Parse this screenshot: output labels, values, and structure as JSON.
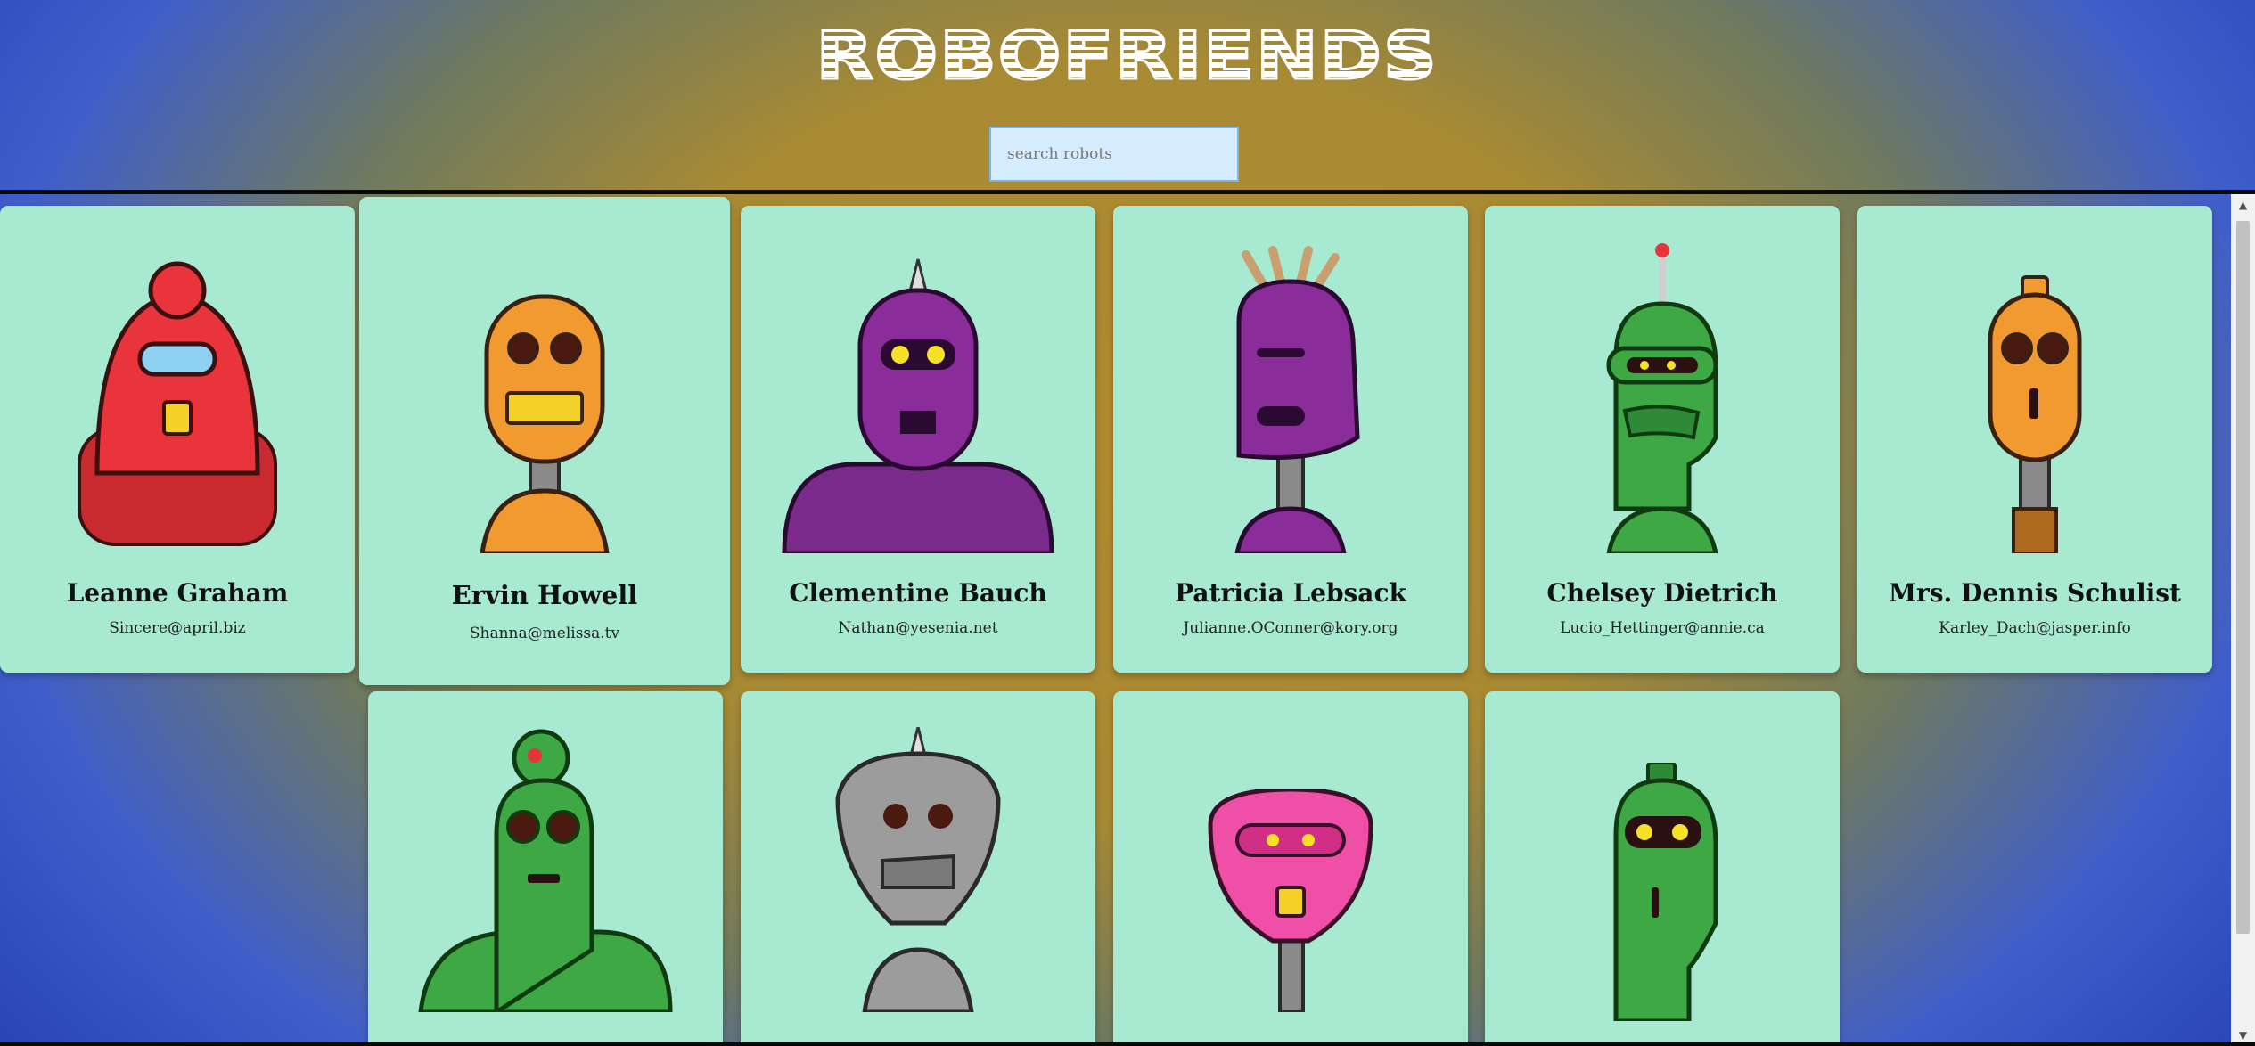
{
  "app": {
    "title": "ROBOFRIENDS"
  },
  "search": {
    "placeholder": "search robots",
    "value": ""
  },
  "robots": [
    {
      "name": "Leanne Graham",
      "email": "Sincere@april.biz",
      "color": "#e8343a"
    },
    {
      "name": "Ervin Howell",
      "email": "Shanna@melissa.tv",
      "color": "#f19a30"
    },
    {
      "name": "Clementine Bauch",
      "email": "Nathan@yesenia.net",
      "color": "#8a2c9a"
    },
    {
      "name": "Patricia Lebsack",
      "email": "Julianne.OConner@kory.org",
      "color": "#8a2c9a"
    },
    {
      "name": "Chelsey Dietrich",
      "email": "Lucio_Hettinger@annie.ca",
      "color": "#3da844"
    },
    {
      "name": "Mrs. Dennis Schulist",
      "email": "Karley_Dach@jasper.info",
      "color": "#f19a30"
    },
    {
      "name": "",
      "email": "",
      "color": "#3da844"
    },
    {
      "name": "",
      "email": "",
      "color": "#9c9c9c"
    },
    {
      "name": "",
      "email": "",
      "color": "#ef4fa6"
    },
    {
      "name": "",
      "email": "",
      "color": "#3da844"
    }
  ],
  "colors": {
    "card_background": "#a8ead1",
    "search_background": "#d6ecff"
  }
}
